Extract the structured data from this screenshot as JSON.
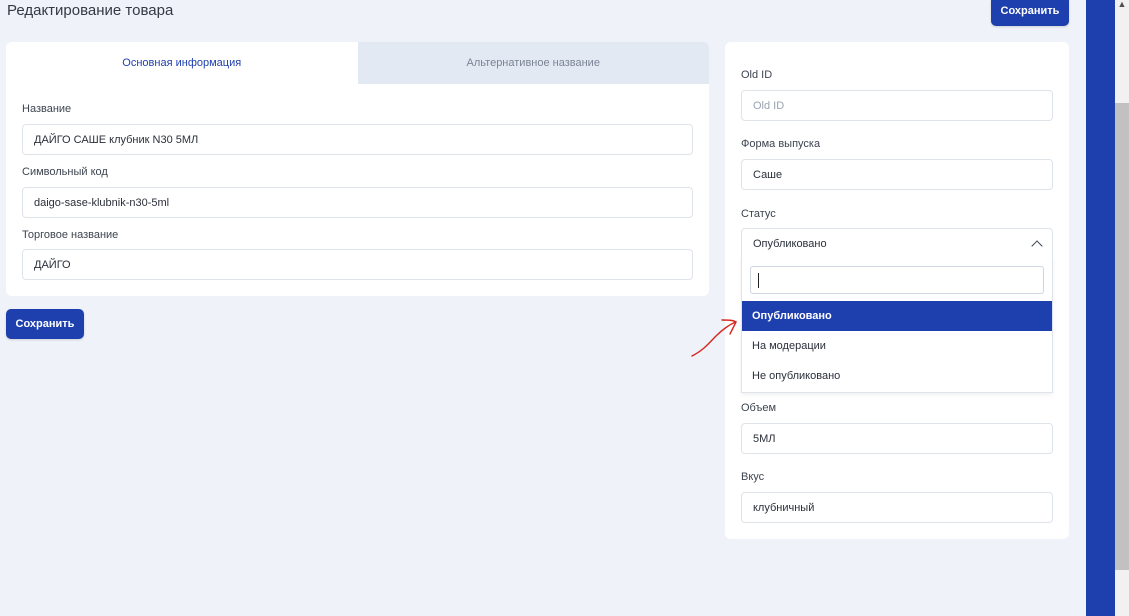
{
  "header": {
    "title": "Редактирование товара",
    "save_label": "Сохранить"
  },
  "tabs": [
    {
      "label": "Основная информация",
      "active": true
    },
    {
      "label": "Альтернативное название",
      "active": false
    }
  ],
  "main_form": {
    "name": {
      "label": "Название",
      "value": "ДАЙГО САШЕ клубник N30 5МЛ"
    },
    "code": {
      "label": "Символьный код",
      "value": "daigo-sase-klubnik-n30-5ml"
    },
    "trade_name": {
      "label": "Торговое название",
      "value": "ДАЙГО"
    }
  },
  "footer": {
    "save_label": "Сохранить"
  },
  "side_form": {
    "old_id": {
      "label": "Old ID",
      "value": "",
      "placeholder": "Old ID"
    },
    "form": {
      "label": "Форма выпуска",
      "value": "Саше"
    },
    "status": {
      "label": "Статус",
      "value": "Опубликовано",
      "search_value": "",
      "options": [
        {
          "label": "Опубликовано",
          "selected": true
        },
        {
          "label": "На модерации",
          "selected": false
        },
        {
          "label": "Не опубликовано",
          "selected": false
        }
      ]
    },
    "volume": {
      "label": "Объем",
      "value": "5МЛ"
    },
    "taste": {
      "label": "Вкус",
      "value": "клубничный"
    }
  },
  "colors": {
    "primary": "#1e3fae",
    "background": "#eff2f8",
    "tab_inactive": "#e3e9f3",
    "annotation": "#d7261e"
  },
  "icons": {
    "select_toggle": "chevron-up-icon",
    "annotation": "red-arrow-icon"
  }
}
